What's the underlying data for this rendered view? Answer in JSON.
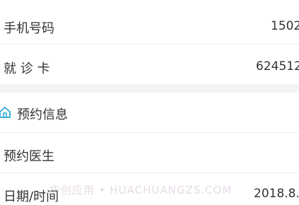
{
  "patient_info": {
    "phone_label": "手机号码",
    "phone_value": "1502",
    "card_label": "就 诊 卡",
    "card_value": "624512"
  },
  "appointment_section": {
    "icon": "home-icon",
    "title": "预约信息",
    "doctor_label": "预约医生",
    "doctor_value": "",
    "datetime_label": "日期/时间",
    "datetime_value": "2018.8."
  },
  "watermark": "华创应用 • HUACHUANGZS.COM",
  "colors": {
    "accent": "#29a7d6",
    "background": "#f2f3f5",
    "card": "#ffffff",
    "divider": "#ececec",
    "text": "#333333"
  }
}
